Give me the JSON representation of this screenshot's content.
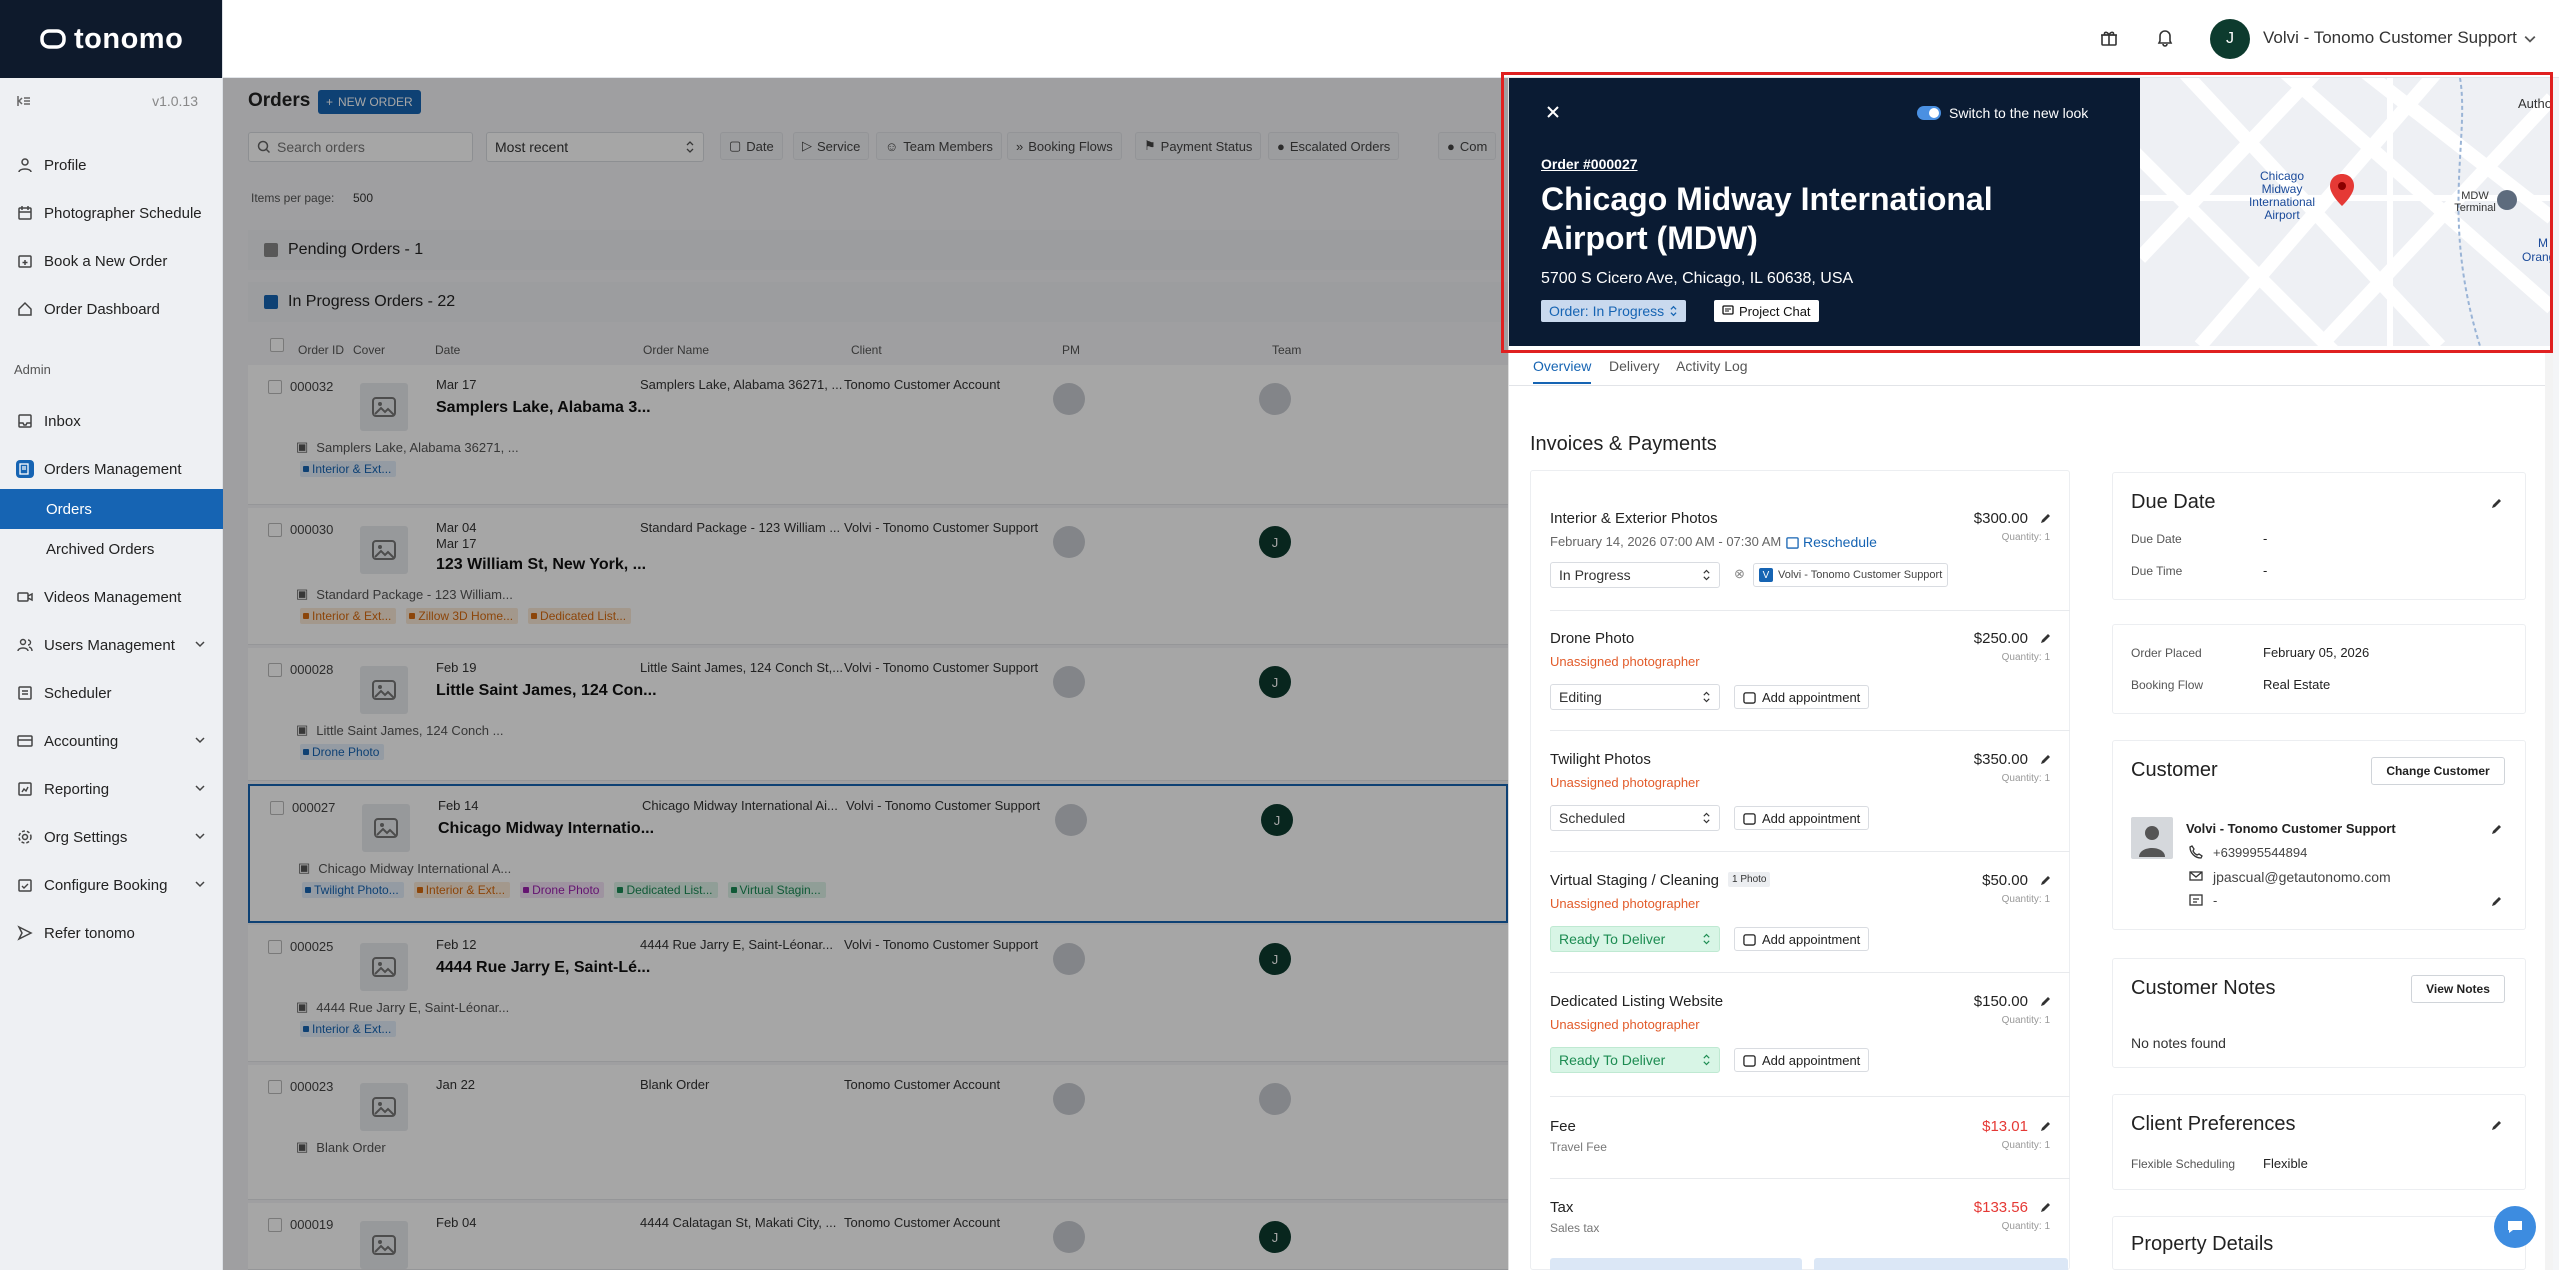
{
  "app": {
    "brand": "tonomo",
    "version": "v1.0.13"
  },
  "header": {
    "user_initial": "J",
    "user_name": "Volvi - Tonomo Customer Support"
  },
  "sidebar": {
    "items": [
      {
        "label": "Profile"
      },
      {
        "label": "Photographer Schedule"
      },
      {
        "label": "Book a New Order"
      },
      {
        "label": "Order Dashboard"
      }
    ],
    "admin_label": "Admin",
    "admin_items": [
      {
        "label": "Inbox"
      },
      {
        "label": "Orders Management"
      },
      {
        "label": "Orders"
      },
      {
        "label": "Archived Orders"
      },
      {
        "label": "Videos Management"
      },
      {
        "label": "Users Management"
      },
      {
        "label": "Scheduler"
      },
      {
        "label": "Accounting"
      },
      {
        "label": "Reporting"
      },
      {
        "label": "Org Settings"
      },
      {
        "label": "Configure Booking"
      },
      {
        "label": "Refer tonomo"
      }
    ]
  },
  "orders": {
    "title": "Orders",
    "new_order": "NEW ORDER",
    "search_placeholder": "Search orders",
    "sort": "Most recent",
    "filters": [
      "Date",
      "Service",
      "Team Members",
      "Booking Flows",
      "Payment Status",
      "Escalated Orders",
      "Com"
    ],
    "items_per_page_label": "Items per page:",
    "items_per_page": "500",
    "groups": {
      "pending": "Pending Orders - 1",
      "in_progress": "In Progress Orders - 22"
    },
    "columns": [
      "Order ID",
      "Cover",
      "Date",
      "Order Name",
      "Client",
      "PM",
      "Team"
    ],
    "rows": [
      {
        "id": "000032",
        "date": "Mar 17",
        "date2": "",
        "title": "Samplers Lake, Alabama 3...",
        "name": "Samplers Lake, Alabama 36271, ...",
        "client": "Tonomo Customer Account",
        "addr": "Samplers Lake, Alabama 36271, ...",
        "team": "",
        "tags": [
          {
            "t": "Interior & Ext...",
            "c": "blue"
          }
        ]
      },
      {
        "id": "000030",
        "date": "Mar 04",
        "date2": "Mar 17",
        "title": "123 William St, New York, ...",
        "name": "Standard Package - 123 William ...",
        "client": "Volvi - Tonomo Customer Support",
        "addr": "Standard Package - 123 William...",
        "team": "J",
        "tags": [
          {
            "t": "Interior & Ext...",
            "c": "orange"
          },
          {
            "t": "Zillow 3D Home...",
            "c": "orange"
          },
          {
            "t": "Dedicated List...",
            "c": "orange"
          }
        ]
      },
      {
        "id": "000028",
        "date": "Feb 19",
        "date2": "",
        "title": "Little Saint James, 124 Con...",
        "name": "Little Saint James, 124 Conch St,...",
        "client": "Volvi - Tonomo Customer Support",
        "addr": "Little Saint James, 124 Conch ...",
        "team": "J",
        "tags": [
          {
            "t": "Drone Photo",
            "c": "blue"
          }
        ]
      },
      {
        "id": "000027",
        "date": "Feb 14",
        "date2": "",
        "title": "Chicago Midway Internatio...",
        "name": "Chicago Midway International Ai...",
        "client": "Volvi - Tonomo Customer Support",
        "addr": "Chicago Midway International A...",
        "team": "J",
        "tags": [
          {
            "t": "Twilight Photo...",
            "c": "blue"
          },
          {
            "t": "Interior & Ext...",
            "c": "orange"
          },
          {
            "t": "Drone Photo",
            "c": "purple"
          },
          {
            "t": "Dedicated List...",
            "c": "green"
          },
          {
            "t": "Virtual Stagin...",
            "c": "green"
          }
        ]
      },
      {
        "id": "000025",
        "date": "Feb 12",
        "date2": "",
        "title": "4444 Rue Jarry E, Saint-Lé...",
        "name": "4444 Rue Jarry E, Saint-Léonar...",
        "client": "Volvi - Tonomo Customer Support",
        "addr": "4444 Rue Jarry E, Saint-Léonar...",
        "team": "J",
        "tags": [
          {
            "t": "Interior & Ext...",
            "c": "blue"
          }
        ]
      },
      {
        "id": "000023",
        "date": "Jan 22",
        "date2": "",
        "title": "",
        "name": "Blank Order",
        "client": "Tonomo Customer Account",
        "addr": "Blank Order",
        "team": "",
        "tags": []
      },
      {
        "id": "000019",
        "date": "Feb 04",
        "date2": "",
        "title": "",
        "name": "4444 Calatagan St, Makati City, ...",
        "client": "Tonomo Customer Account",
        "addr": "",
        "team": "J",
        "tags": []
      }
    ]
  },
  "panel": {
    "switch_label": "Switch to the new look",
    "order_number": "Order #000027",
    "title": "Chicago Midway International Airport (MDW)",
    "address": "5700 S Cicero Ave, Chicago, IL 60638, USA",
    "status": "Order: In Progress",
    "chat": "Project Chat",
    "map": {
      "label1": "Chicago Midway International Airport",
      "label2": "MDW Terminal",
      "label3": "Authori",
      "label4": "M",
      "label5": "Orange"
    },
    "tabs": [
      "Overview",
      "Delivery",
      "Activity Log"
    ],
    "invoices_title": "Invoices & Payments",
    "line_items": [
      {
        "name": "Interior & Exterior Photos",
        "price": "$300.00",
        "qty": "Quantity: 1",
        "when": "February 14, 2026 07:00 AM - 07:30 AM",
        "reschedule": "Reschedule",
        "status": "In Progress",
        "assignee_initial": "V",
        "assignee": "Volvi - Tonomo Customer Support"
      },
      {
        "name": "Drone Photo",
        "price": "$250.00",
        "qty": "Quantity: 1",
        "unassigned": "Unassigned photographer",
        "status": "Editing",
        "add": "Add appointment"
      },
      {
        "name": "Twilight Photos",
        "price": "$350.00",
        "qty": "Quantity: 1",
        "unassigned": "Unassigned photographer",
        "status": "Scheduled",
        "add": "Add appointment"
      },
      {
        "name": "Virtual Staging / Cleaning",
        "badge": "1 Photo",
        "price": "$50.00",
        "qty": "Quantity: 1",
        "unassigned": "Unassigned photographer",
        "status": "Ready To Deliver",
        "add": "Add appointment"
      },
      {
        "name": "Dedicated Listing Website",
        "price": "$150.00",
        "qty": "Quantity: 1",
        "unassigned": "Unassigned photographer",
        "status": "Ready To Deliver",
        "add": "Add appointment"
      }
    ],
    "fee": {
      "name": "Fee",
      "sub": "Travel Fee",
      "price": "$13.01",
      "qty": "Quantity: 1"
    },
    "tax": {
      "name": "Tax",
      "sub": "Sales tax",
      "price": "$133.56",
      "qty": "Quantity: 1"
    },
    "due": {
      "title": "Due Date",
      "date_label": "Due Date",
      "date_value": "-",
      "time_label": "Due Time",
      "time_value": "-"
    },
    "placed": {
      "label": "Order Placed",
      "value": "February 05, 2026",
      "flow_label": "Booking Flow",
      "flow_value": "Real Estate"
    },
    "customer": {
      "title": "Customer",
      "change": "Change Customer",
      "name": "Volvi - Tonomo Customer Support",
      "phone": "+639995544894",
      "email": "jpascual@getautonomo.com",
      "extra": "-"
    },
    "notes": {
      "title": "Customer Notes",
      "view": "View Notes",
      "empty": "No notes found"
    },
    "prefs": {
      "title": "Client Preferences",
      "label": "Flexible Scheduling",
      "value": "Flexible"
    },
    "property": {
      "title": "Property Details"
    }
  },
  "colors": {
    "accent": "#1664b3",
    "hero": "#0a1b33",
    "warn": "#e25b2a",
    "price_red": "#e53935"
  }
}
